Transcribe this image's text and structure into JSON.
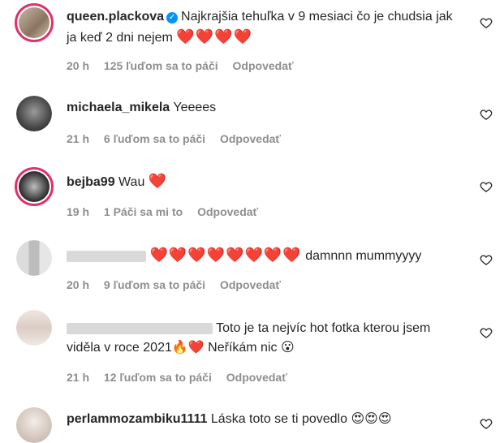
{
  "comments": [
    {
      "username": "queen.plackova",
      "verified": true,
      "text": "Najkrajšia tehuľka v 9 mesiaci čo je chudsia jak ja keď 2 dni nejem",
      "hearts": "❤️❤️❤️❤️",
      "time": "20 h",
      "likes": "125 ľuďom sa to páči",
      "reply": "Odpovedať"
    },
    {
      "username": "michaela_mikela",
      "text": "Yeeees",
      "time": "21 h",
      "likes": "6 ľuďom sa to páči",
      "reply": "Odpovedať"
    },
    {
      "username": "bejba99",
      "text": "Wau",
      "hearts": "❤️",
      "time": "19 h",
      "likes": "1 Páči sa mi to",
      "reply": "Odpovedať"
    },
    {
      "username": "",
      "hearts": "❤️❤️❤️❤️❤️❤️❤️❤️",
      "text": "damnnn mummyyyy",
      "time": "20 h",
      "likes": "9 ľuďom sa to páči",
      "reply": "Odpovedať"
    },
    {
      "username": "",
      "text": "Toto je ta nejvíc hot fotka kterou jsem viděla v roce 2021",
      "emoji_a": "🔥❤️",
      "text2": "Neříkám nic",
      "emoji_b": "😮",
      "time": "21 h",
      "likes": "12 ľuďom sa to páči",
      "reply": "Odpovedať"
    },
    {
      "username": "perlammozambiku1111",
      "text": "Láska toto se ti povedlo",
      "emoji": "😍😍😍"
    }
  ],
  "icons": {
    "like": "heart-outline-icon"
  }
}
